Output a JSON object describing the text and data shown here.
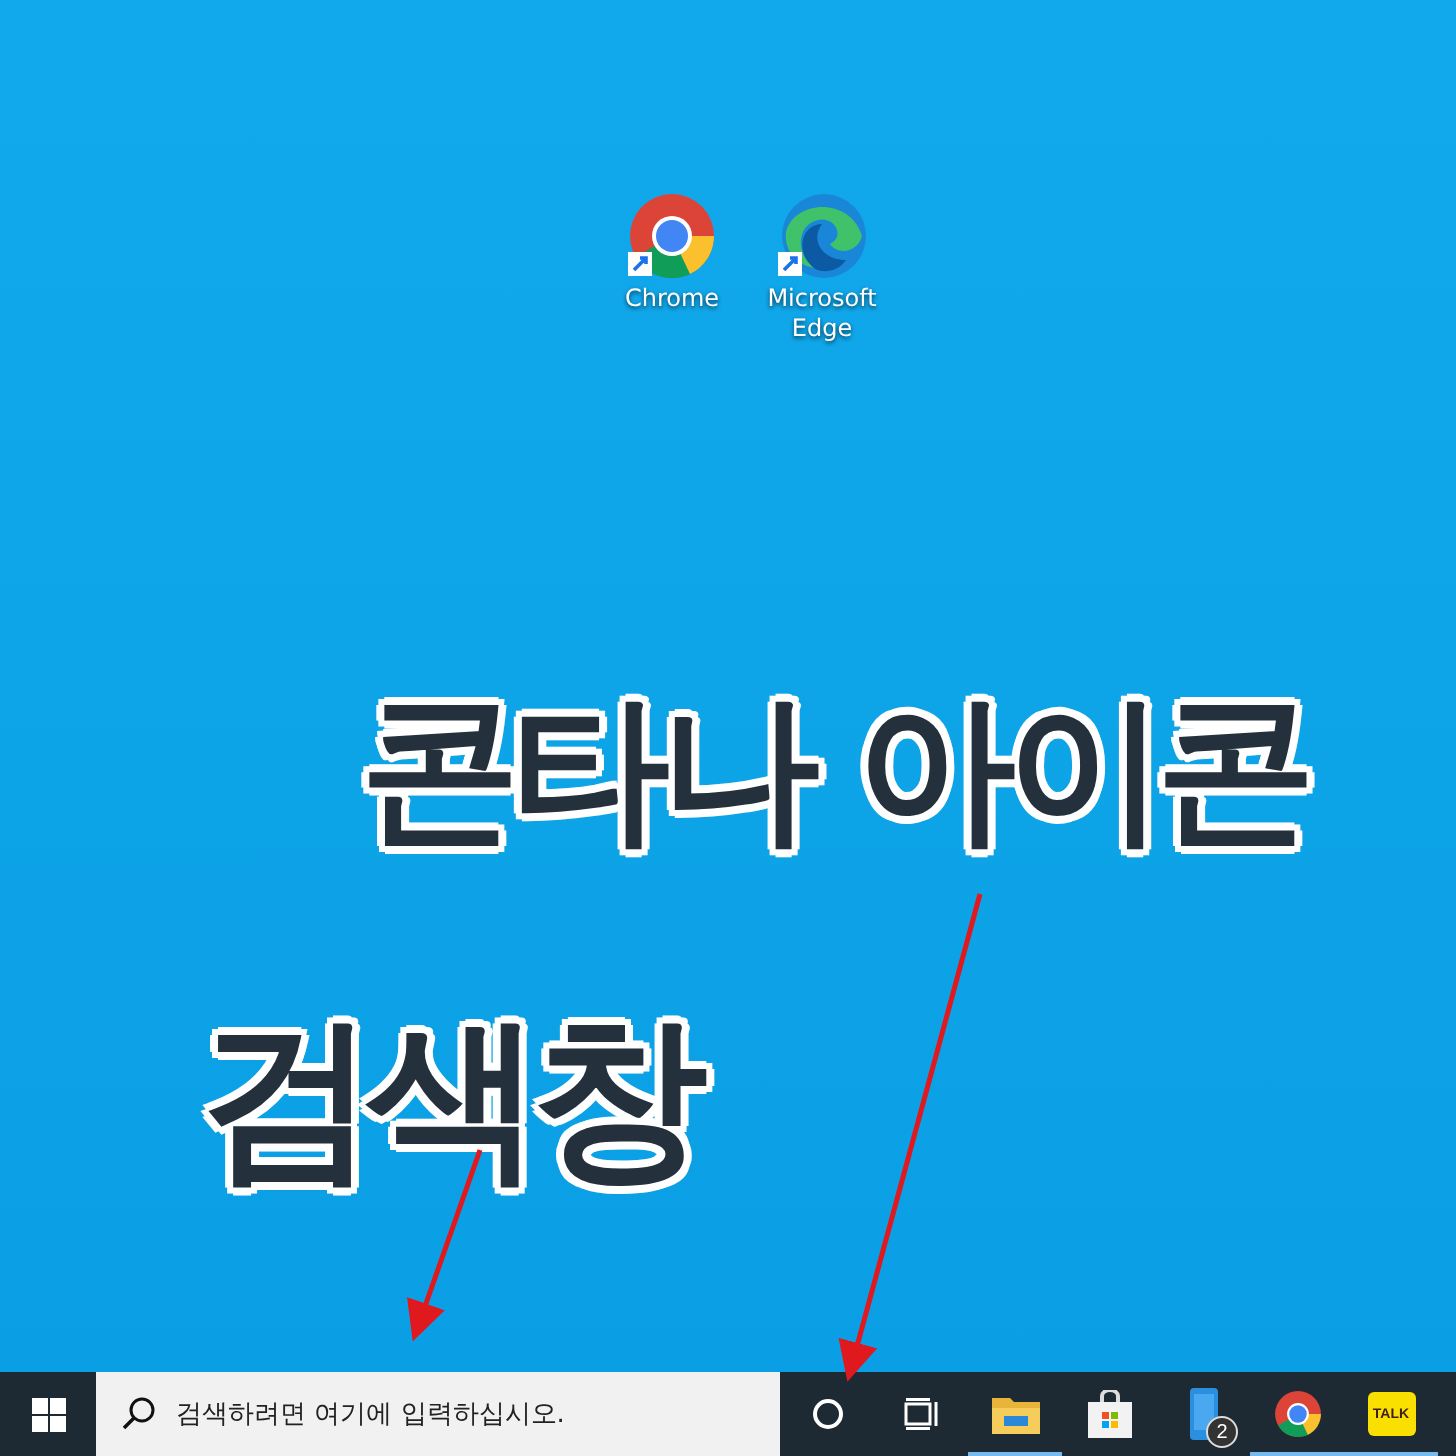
{
  "desktop": {
    "shortcuts": [
      {
        "label": "Chrome",
        "kind": "chrome"
      },
      {
        "label": "Microsoft Edge",
        "kind": "edge"
      }
    ]
  },
  "annotations": [
    {
      "text": "콘타나 아이콘",
      "kind": "cortana"
    },
    {
      "text": "검색창",
      "kind": "search"
    }
  ],
  "taskbar": {
    "search": {
      "placeholder": "검색하려면 여기에 입력하십시오."
    },
    "apps": [
      {
        "kind": "explorer",
        "running": true
      },
      {
        "kind": "store",
        "running": false
      },
      {
        "kind": "phone",
        "running": false,
        "badge": "2"
      },
      {
        "kind": "chrome",
        "running": true
      },
      {
        "kind": "kakao",
        "running": true,
        "icon_text": "TALK"
      }
    ]
  }
}
